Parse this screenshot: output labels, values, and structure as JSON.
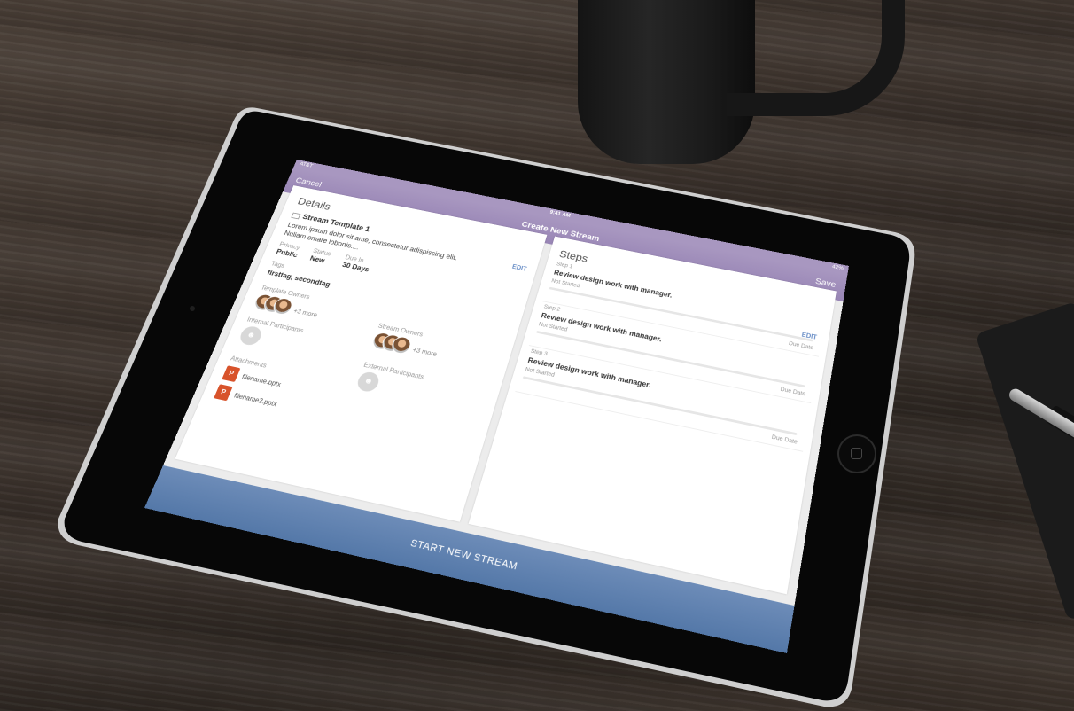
{
  "status_bar": {
    "carrier": "AT&T",
    "time": "9:41 AM",
    "battery": "42%"
  },
  "nav": {
    "cancel": "Cancel",
    "title": "Create New Stream",
    "save": "Save"
  },
  "details": {
    "heading": "Details",
    "template_name": "Stream Template 1",
    "description": "Lorem ipsum dolor sit ame, consectetur adispiscing elit. Nuliam omare lobortis....",
    "edit": "EDIT",
    "privacy_label": "Privacy",
    "privacy_value": "Public",
    "status_label": "Status",
    "status_value": "New",
    "due_label": "Due In",
    "due_value": "30 Days",
    "tags_label": "Tags",
    "tags_value": "firsttag, secondtag",
    "template_owners_label": "Template Owners",
    "template_owners_more": "+3 more",
    "stream_owners_label": "Stream Owners",
    "stream_owners_more": "+3 more",
    "internal_label": "Internal Participants",
    "external_label": "External Participants",
    "attachments_label": "Attachments",
    "files": [
      "filename.pptx",
      "filename2.pptx"
    ]
  },
  "steps": {
    "heading": "Steps",
    "edit": "EDIT",
    "items": [
      {
        "number": "Step 1",
        "title": "Review design work with manager.",
        "status": "Not Started",
        "due": "Due Date"
      },
      {
        "number": "Step 2",
        "title": "Review design work with manager.",
        "status": "Not Started",
        "due": "Due Date"
      },
      {
        "number": "Step 3",
        "title": "Review design work with manager.",
        "status": "Not Started",
        "due": "Due Date"
      }
    ]
  },
  "footer": {
    "cta": "START NEW STREAM"
  }
}
